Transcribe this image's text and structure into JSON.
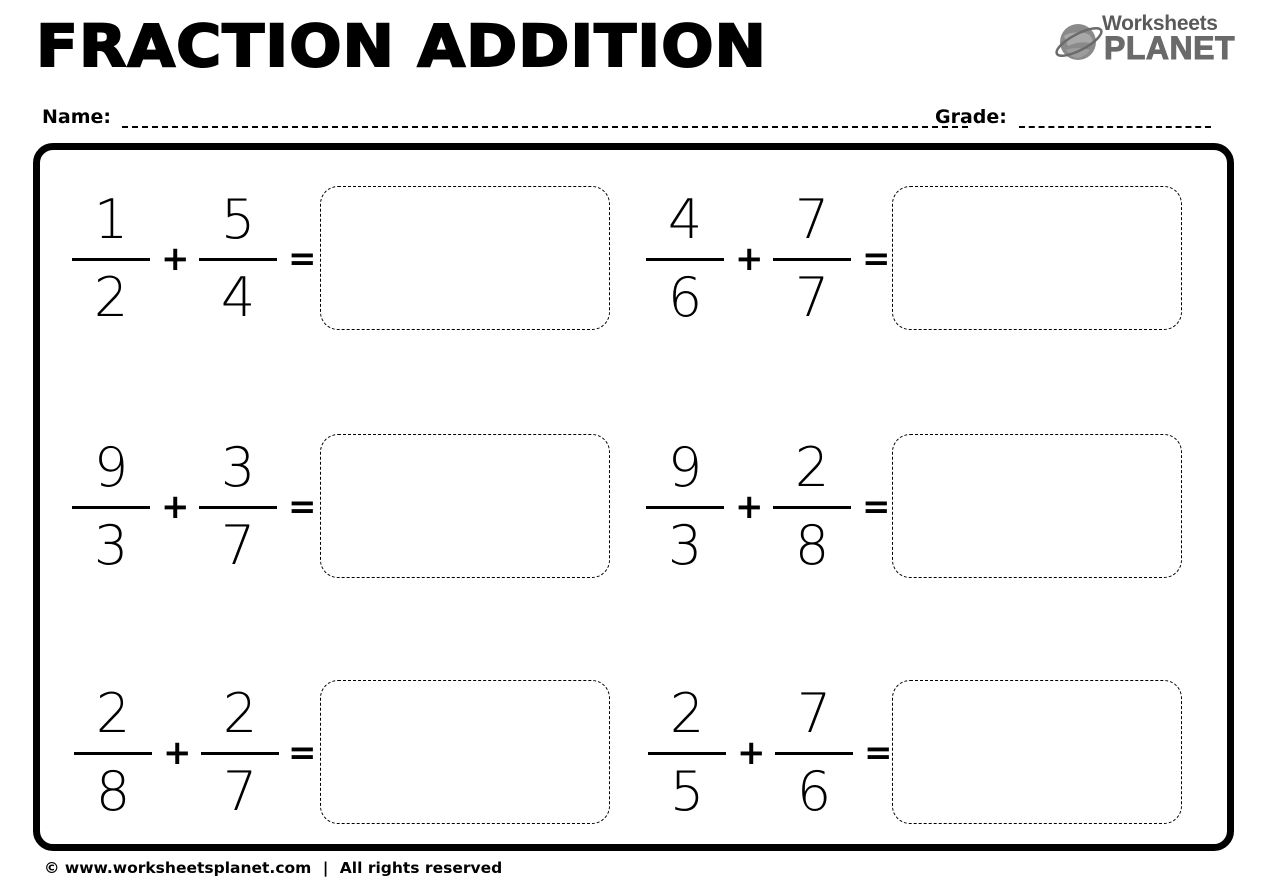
{
  "header": {
    "title": "FRACTION ADDITION",
    "logo": {
      "icon": "planet-icon",
      "line1": "Worksheets",
      "line2": "PLANET"
    }
  },
  "student_fields": {
    "name_label": "Name:",
    "name_value": "",
    "grade_label": "Grade:",
    "grade_value": ""
  },
  "operators": {
    "plus": "+",
    "equals": "="
  },
  "problems": [
    {
      "a": {
        "num": "1",
        "den": "2"
      },
      "b": {
        "num": "5",
        "den": "4"
      },
      "answer": ""
    },
    {
      "a": {
        "num": "4",
        "den": "6"
      },
      "b": {
        "num": "7",
        "den": "7"
      },
      "answer": ""
    },
    {
      "a": {
        "num": "9",
        "den": "3"
      },
      "b": {
        "num": "3",
        "den": "7"
      },
      "answer": ""
    },
    {
      "a": {
        "num": "9",
        "den": "3"
      },
      "b": {
        "num": "2",
        "den": "8"
      },
      "answer": ""
    },
    {
      "a": {
        "num": "2",
        "den": "8"
      },
      "b": {
        "num": "2",
        "den": "7"
      },
      "answer": ""
    },
    {
      "a": {
        "num": "2",
        "den": "5"
      },
      "b": {
        "num": "7",
        "den": "6"
      },
      "answer": ""
    }
  ],
  "footer": {
    "copyright_icon": "©",
    "website": "www.worksheetsplanet.com",
    "separator": "|",
    "rights": "All rights reserved"
  }
}
